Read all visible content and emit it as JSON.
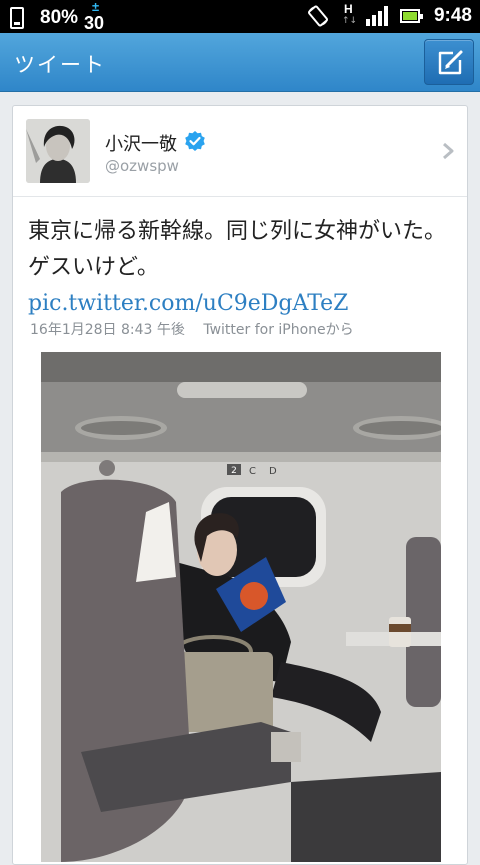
{
  "status_bar": {
    "battery_percent": "80%",
    "temperature_symbol": "±",
    "temperature_value": "30",
    "network_type": "H",
    "network_arrows": "↑↓",
    "time": "9:48"
  },
  "title_bar": {
    "title": "ツイート",
    "compose_icon": "compose-icon"
  },
  "tweet": {
    "display_name": "小沢一敬",
    "verified": true,
    "screen_name": "@ozwspw",
    "text": "東京に帰る新幹線。同じ列に女神がいた。ゲスいけど。",
    "link": "pic.twitter.com/uC9eDgATeZ",
    "timestamp": "16年1月28日 8:43 午後",
    "source": "Twitter for iPhoneから",
    "photo": {
      "sign_number": "2",
      "sign_seat_c": "C",
      "sign_seat_d": "D"
    }
  },
  "colors": {
    "title_bar": "#3b93d3",
    "link": "#2d7fc2",
    "verified": "#1da1f2"
  }
}
